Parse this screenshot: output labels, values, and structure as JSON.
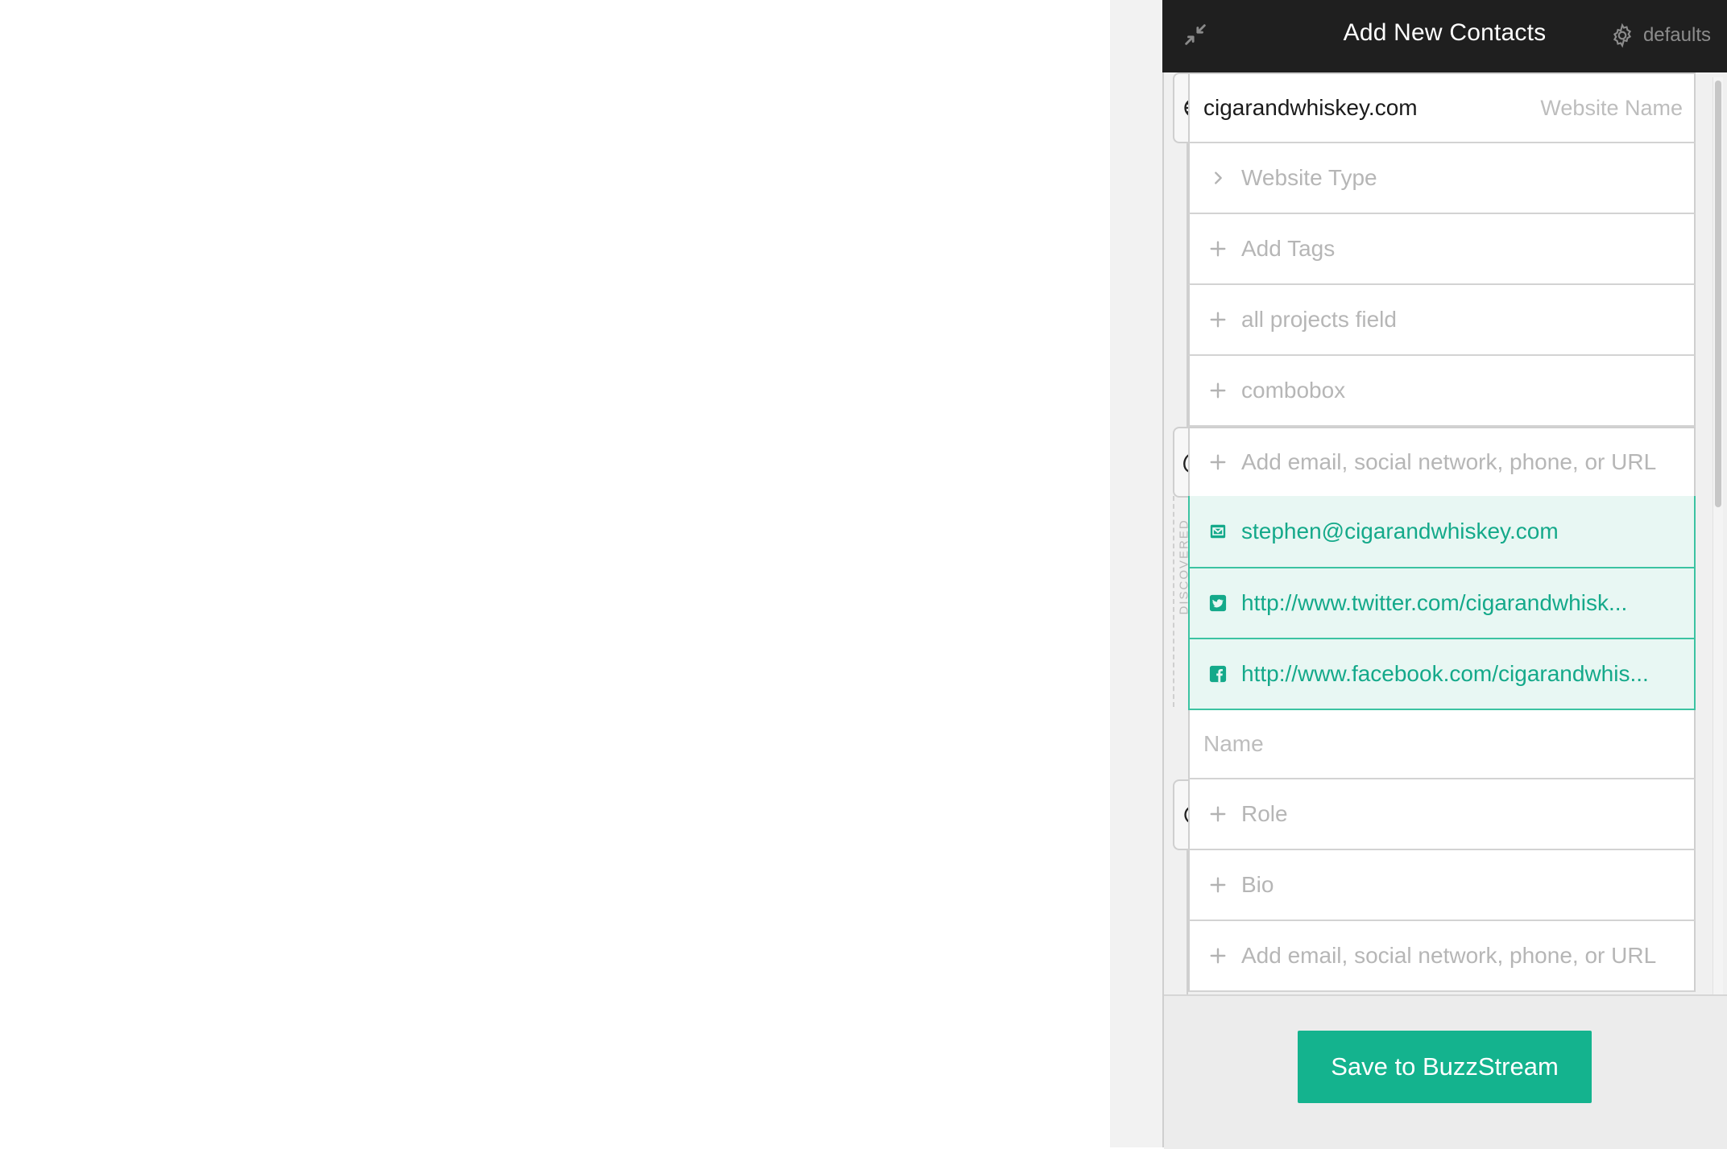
{
  "header": {
    "title": "Add New Contacts",
    "defaults_label": "defaults"
  },
  "website": {
    "value": "cigarandwhiskey.com",
    "placeholder": "Website Name",
    "type_label": "Website Type",
    "tags_label": "Add Tags",
    "projects_label": "all projects field",
    "combobox_label": "combobox"
  },
  "contact_methods": {
    "add_label": "Add email, social network, phone, or URL",
    "discovered_label": "DISCOVERED",
    "items": [
      {
        "icon": "email-icon",
        "value": "stephen@cigarandwhiskey.com"
      },
      {
        "icon": "twitter-icon",
        "value": "http://www.twitter.com/cigarandwhisk..."
      },
      {
        "icon": "facebook-icon",
        "value": "http://www.facebook.com/cigarandwhis..."
      }
    ]
  },
  "person": {
    "name_placeholder": "Name",
    "role_label": "Role",
    "bio_label": "Bio",
    "add_label": "Add email, social network, phone, or URL"
  },
  "footer": {
    "save_label": "Save to BuzzStream"
  },
  "colors": {
    "accent": "#14b38e",
    "header_bg": "#1f1f1f",
    "discovered_bg": "#e8f7f3"
  }
}
